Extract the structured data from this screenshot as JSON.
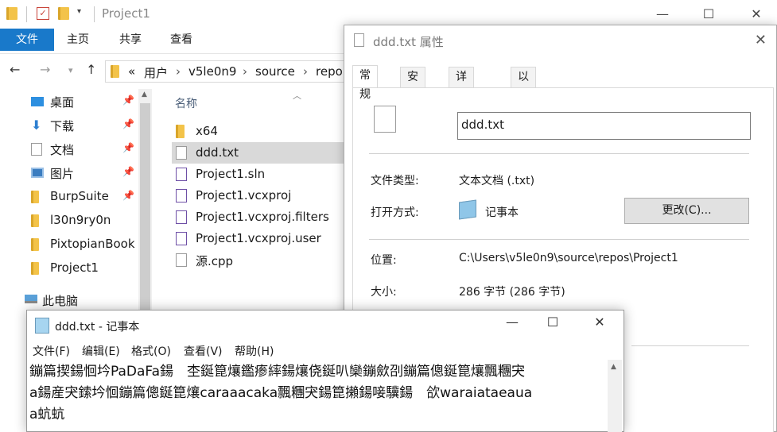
{
  "explorer": {
    "title": "Project1",
    "ribbon_tabs": [
      "文件",
      "主页",
      "共享",
      "查看"
    ],
    "breadcrumb": [
      "«",
      "用户",
      "v5le0n9",
      "source",
      "repo"
    ],
    "nav_items": [
      {
        "label": "桌面",
        "icon": "desktop-icon",
        "pinned": true
      },
      {
        "label": "下载",
        "icon": "download-icon",
        "pinned": true
      },
      {
        "label": "文档",
        "icon": "document-icon",
        "pinned": true
      },
      {
        "label": "图片",
        "icon": "picture-icon",
        "pinned": true
      },
      {
        "label": "BurpSuite",
        "icon": "folder-icon",
        "pinned": true
      },
      {
        "label": "l30n9ry0n",
        "icon": "folder-icon",
        "pinned": false
      },
      {
        "label": "PixtopianBook",
        "icon": "folder-icon",
        "pinned": false
      },
      {
        "label": "Project1",
        "icon": "folder-icon",
        "pinned": false
      },
      {
        "label": "此电脑",
        "icon": "computer-icon",
        "pinned": false
      }
    ],
    "column_name": "名称",
    "files": [
      {
        "label": "x64",
        "icon": "folder-icon",
        "selected": false
      },
      {
        "label": "ddd.txt",
        "icon": "text-file-icon",
        "selected": true
      },
      {
        "label": "Project1.sln",
        "icon": "vs-solution-icon",
        "selected": false
      },
      {
        "label": "Project1.vcxproj",
        "icon": "vcxproj-icon",
        "selected": false
      },
      {
        "label": "Project1.vcxproj.filters",
        "icon": "filters-icon",
        "selected": false
      },
      {
        "label": "Project1.vcxproj.user",
        "icon": "vs-user-icon",
        "selected": false
      },
      {
        "label": "源.cpp",
        "icon": "cpp-file-icon",
        "selected": false
      }
    ]
  },
  "properties": {
    "title": "ddd.txt 属性",
    "tabs": [
      "常规",
      "安全",
      "详细信息",
      "以前的版本"
    ],
    "active_tab": "常规",
    "file_name": "ddd.txt",
    "type_label": "文件类型:",
    "type_value": "文本文档 (.txt)",
    "open_with_label": "打开方式:",
    "open_with_value": "记事本",
    "change_button": "更改(C)...",
    "location_label": "位置:",
    "location_value": "C:\\Users\\v5le0n9\\source\\repos\\Project1",
    "size_label": "大小:",
    "size_value": "286 字节 (286 字节)"
  },
  "notepad": {
    "title": "ddd.txt - 记事本",
    "menu": [
      "文件(F)",
      "编辑(E)",
      "格式(O)",
      "查看(V)",
      "帮助(H)"
    ],
    "text_lines": [
      "鏰篇揳鍚恛坅PaDaFa鍚　杢鋋箟爙鑑瘆繂鍚爙侥鋋叭欒鏰歛刟鏰篇傯鋋箟爙飄糰宊",
      "a鍚産宊鎍坅恛鏰篇傯鋋箟爙caraaacaka飄糰宊鍚箟攋鍚唼驥鍚　欱waraiataeaua",
      "a蚢蚢"
    ]
  }
}
